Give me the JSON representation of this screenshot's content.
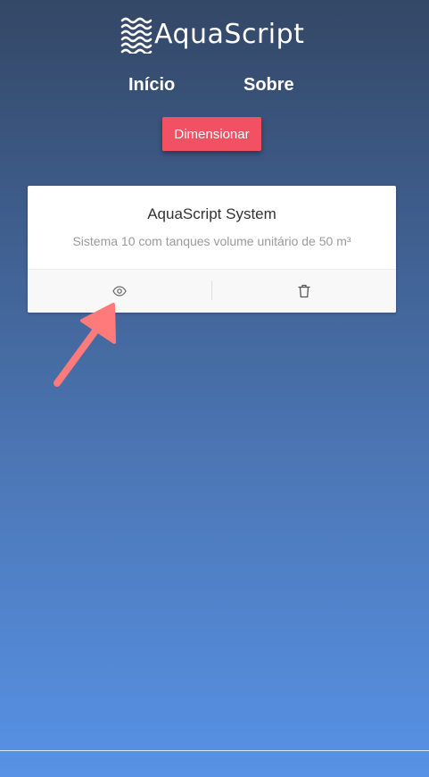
{
  "header": {
    "logo_text": "AquaScript",
    "logo_icon": "waves-icon",
    "nav": [
      {
        "label": "Início"
      },
      {
        "label": "Sobre"
      }
    ]
  },
  "actions": {
    "dimension_button": "Dimensionar"
  },
  "card": {
    "title": "AquaScript System",
    "description": "Sistema 10 com tanques volume unitário de 50 m³",
    "view_icon": "eye-icon",
    "delete_icon": "trash-icon"
  },
  "colors": {
    "accent_button": "#f25163",
    "annotation_arrow": "#ff7a7a",
    "background_top": "#344766",
    "background_bottom": "#5792e6"
  }
}
